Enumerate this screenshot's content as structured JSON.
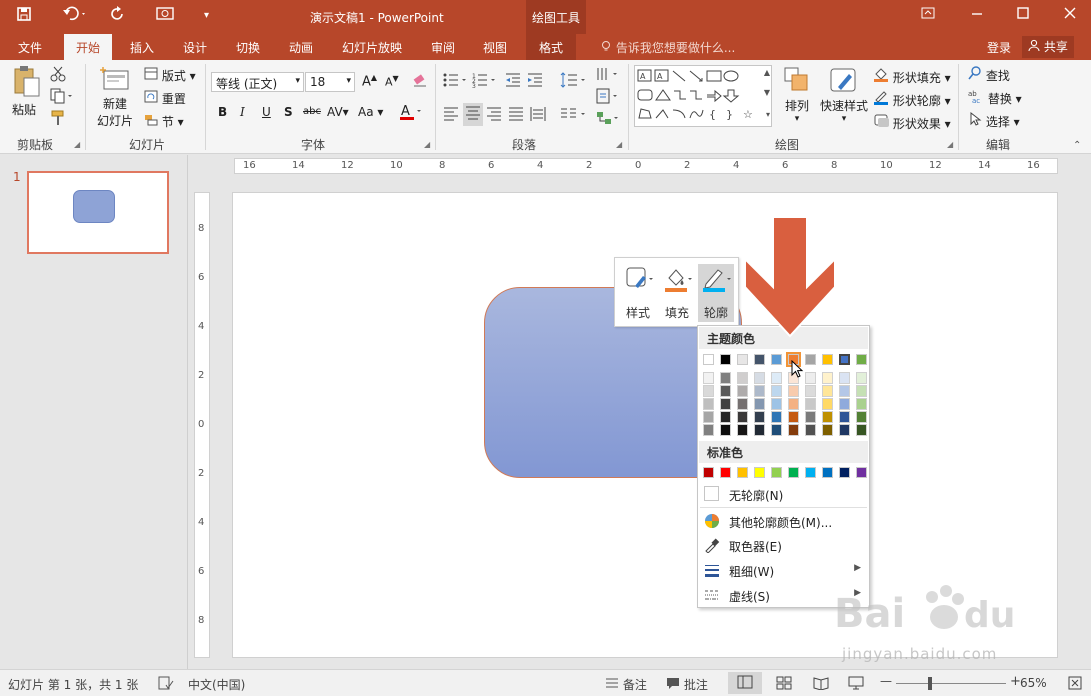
{
  "app": {
    "window_title": "演示文稿1 - PowerPoint",
    "context_tool": "绘图工具"
  },
  "tabs": [
    {
      "label": "文件"
    },
    {
      "label": "开始"
    },
    {
      "label": "插入"
    },
    {
      "label": "设计"
    },
    {
      "label": "切换"
    },
    {
      "label": "动画"
    },
    {
      "label": "幻灯片放映"
    },
    {
      "label": "审阅"
    },
    {
      "label": "视图"
    },
    {
      "label": "格式"
    }
  ],
  "tell_me": "告诉我您想要做什么...",
  "account": {
    "login": "登录",
    "share": "共享"
  },
  "ribbon": {
    "clipboard": {
      "group": "剪贴板",
      "paste": "粘贴"
    },
    "slides": {
      "group": "幻灯片",
      "new_slide_1": "新建",
      "new_slide_2": "幻灯片",
      "layout": "版式",
      "reset": "重置",
      "section": "节"
    },
    "font": {
      "group": "字体",
      "font_name": "等线 (正文)",
      "font_size": "18"
    },
    "paragraph": {
      "group": "段落"
    },
    "drawing": {
      "group": "绘图",
      "arrange": "排列",
      "quick_styles": "快速样式",
      "shape_fill": "形状填充",
      "shape_outline": "形状轮廓",
      "shape_effects": "形状效果"
    },
    "editing": {
      "group": "编辑",
      "find": "查找",
      "replace": "替换",
      "select": "选择"
    }
  },
  "thumbnails": {
    "slide_number": "1"
  },
  "mini_toolbar": {
    "style": "样式",
    "fill": "填充",
    "outline": "轮廓"
  },
  "outline_menu": {
    "theme_colors_label": "主题颜色",
    "standard_colors_label": "标准色",
    "no_outline": "无轮廓(N)",
    "more_colors": "其他轮廓颜色(M)...",
    "eyedropper": "取色器(E)",
    "weight": "粗细(W)",
    "dashes": "虚线(S)",
    "theme_colors": [
      "#ffffff",
      "#000000",
      "#e7e6e6",
      "#44546a",
      "#5b9bd5",
      "#ed7d31",
      "#a5a5a5",
      "#ffc000",
      "#4472c4",
      "#70ad47"
    ],
    "theme_shades": [
      [
        "#f2f2f2",
        "#d9d9d9",
        "#bfbfbf",
        "#a6a6a6",
        "#808080"
      ],
      [
        "#7f7f7f",
        "#595959",
        "#404040",
        "#262626",
        "#0d0d0d"
      ],
      [
        "#d0cece",
        "#aeabab",
        "#757070",
        "#3a3838",
        "#171616"
      ],
      [
        "#d6dce4",
        "#adb9ca",
        "#8497b0",
        "#333f4f",
        "#222a35"
      ],
      [
        "#ddebf7",
        "#bdd7ee",
        "#9dc3e6",
        "#2e75b5",
        "#1f4e79"
      ],
      [
        "#fbe5d6",
        "#f8cbad",
        "#f4b183",
        "#c55a11",
        "#843c0c"
      ],
      [
        "#ededed",
        "#dbdbdb",
        "#c9c9c9",
        "#7b7b7b",
        "#525252"
      ],
      [
        "#fff2cc",
        "#ffe699",
        "#ffd966",
        "#bf9000",
        "#7f6000"
      ],
      [
        "#dae3f3",
        "#b4c7e7",
        "#8faadc",
        "#2f5597",
        "#203864"
      ],
      [
        "#e2f0d9",
        "#c5e0b4",
        "#a9d18e",
        "#538135",
        "#375623"
      ]
    ],
    "standard_colors": [
      "#c00000",
      "#ff0000",
      "#ffc000",
      "#ffff00",
      "#92d050",
      "#00b050",
      "#00b0f0",
      "#0070c0",
      "#002060",
      "#7030a0"
    ],
    "highlighted_theme_index": 5,
    "selected_theme_index": 8
  },
  "status": {
    "slide_info": "幻灯片 第 1 张，共 1 张",
    "language": "中文(中国)",
    "notes": "备注",
    "comments": "批注",
    "zoom": "65%"
  },
  "watermark": {
    "url": "jingyan.baidu.com"
  },
  "colors": {
    "accent": "#b7472a",
    "shape_fill": "#8ea3d6",
    "shape_outline": "#d07a57",
    "arrow": "#d95f3f"
  }
}
